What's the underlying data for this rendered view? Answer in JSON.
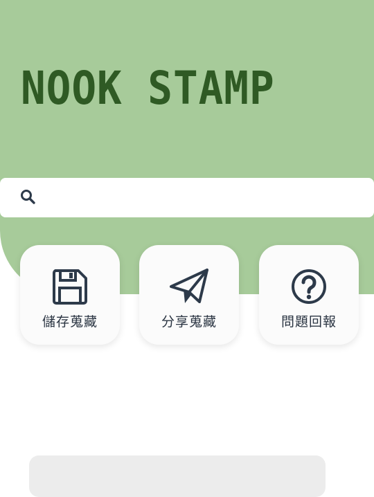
{
  "app": {
    "title": "NOOK STAMP"
  },
  "search": {
    "icon": "search-icon",
    "value": "",
    "placeholder": ""
  },
  "actions": [
    {
      "label": "儲存蒐藏",
      "icon": "floppy-disk-icon"
    },
    {
      "label": "分享蒐藏",
      "icon": "paper-plane-icon"
    },
    {
      "label": "問題回報",
      "icon": "question-circle-icon"
    }
  ],
  "colors": {
    "header_bg": "#a7cb9a",
    "title": "#2f5a24",
    "icon": "#2d3a4a",
    "card_bg": "#fbfbfb",
    "panel_bg": "#ececec"
  }
}
